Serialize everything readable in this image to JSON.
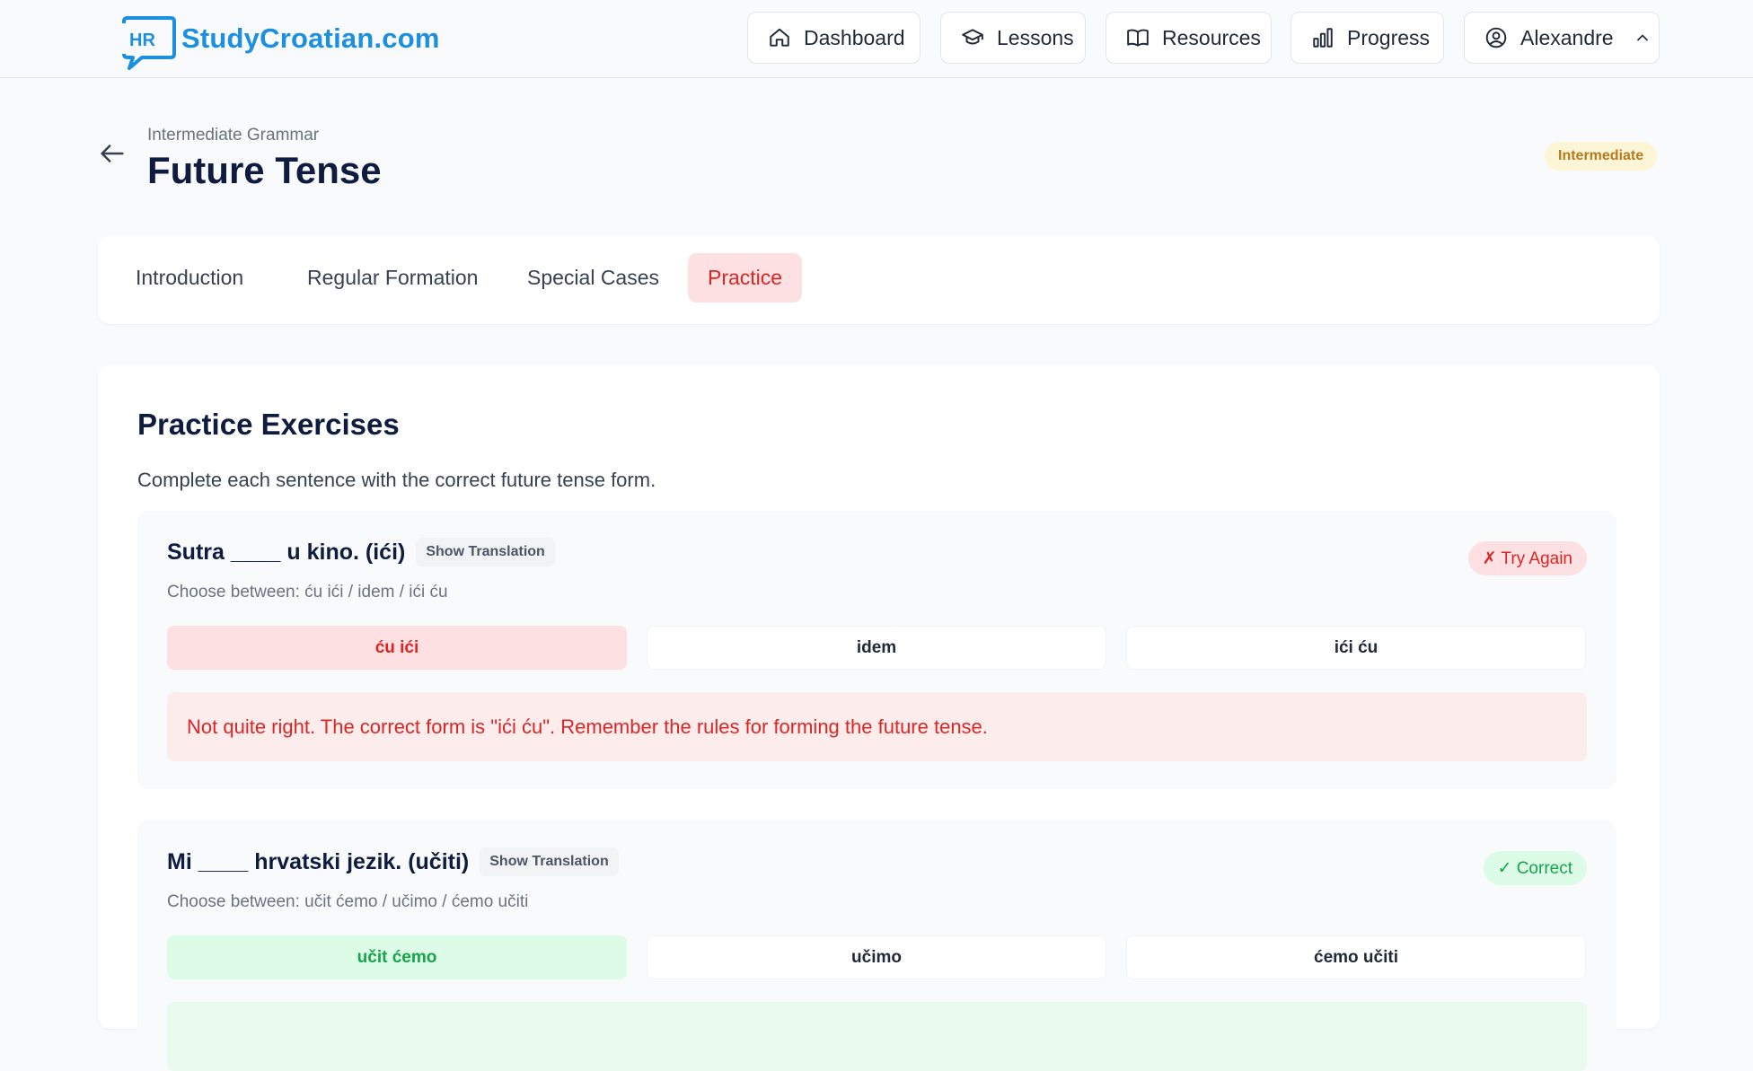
{
  "brand": {
    "logo_badge": "HR",
    "name": "StudyCroatian.com",
    "accent": "#1d8fe0"
  },
  "nav": {
    "dashboard": "Dashboard",
    "lessons": "Lessons",
    "resources": "Resources",
    "progress": "Progress",
    "user": "Alexandre"
  },
  "header": {
    "breadcrumb": "Intermediate Grammar",
    "title": "Future Tense",
    "level": "Intermediate"
  },
  "tabs": {
    "introduction": "Introduction",
    "regular": "Regular Formation",
    "special": "Special Cases",
    "practice": "Practice",
    "active": "Practice"
  },
  "practice": {
    "title": "Practice Exercises",
    "description": "Complete each sentence with the correct future tense form."
  },
  "exercises": [
    {
      "question": "Sutra ____ u kino. (ići)",
      "translation_button": "Show Translation",
      "hint": "Choose between: ću ići / idem / ići ću",
      "status": "✗ Try Again",
      "options": [
        "ću ići",
        "idem",
        "ići ću"
      ],
      "selected": "ću ići",
      "feedback": "Not quite right. The correct form is \"ići ću\". Remember the rules for forming the future tense."
    },
    {
      "question": "Mi ____ hrvatski jezik. (učiti)",
      "translation_button": "Show Translation",
      "hint": "Choose between: učit ćemo / učimo / ćemo učiti",
      "status": "✓ Correct",
      "options": [
        "učit ćemo",
        "učimo",
        "ćemo učiti"
      ],
      "selected": "učit ćemo",
      "feedback": ""
    }
  ],
  "colors": {
    "wrong": "#dc2626",
    "correct": "#16a34a",
    "level_badge": "#b7791f",
    "heading": "#0f1c3f"
  }
}
